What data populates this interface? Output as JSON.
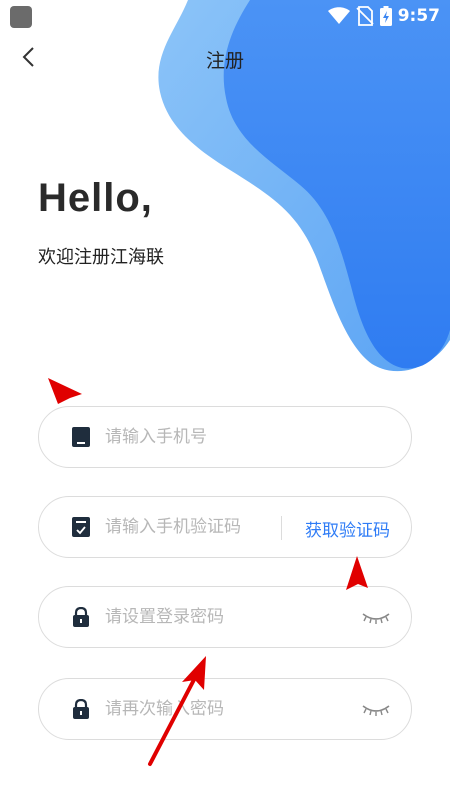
{
  "status_bar": {
    "time": "9:57"
  },
  "header": {
    "title": "注册"
  },
  "greeting": {
    "hello": "Hello,",
    "welcome": "欢迎注册江海联"
  },
  "form": {
    "phone": {
      "placeholder": "请输入手机号",
      "value": ""
    },
    "code": {
      "placeholder": "请输入手机验证码",
      "value": "",
      "get_code_label": "获取验证码"
    },
    "password": {
      "placeholder": "请设置登录密码",
      "value": ""
    },
    "confirm_password": {
      "placeholder": "请再次输入密码",
      "value": ""
    }
  },
  "colors": {
    "accent": "#2f7cf6",
    "blob_light": "#7ab8f7",
    "blob_dark": "#3b86f2",
    "annotation": "#e00000"
  },
  "icons": [
    "back-icon",
    "wifi-icon",
    "no-sim-icon",
    "battery-charging-icon",
    "phone-icon",
    "verify-code-icon",
    "lock-icon",
    "eye-closed-icon"
  ]
}
